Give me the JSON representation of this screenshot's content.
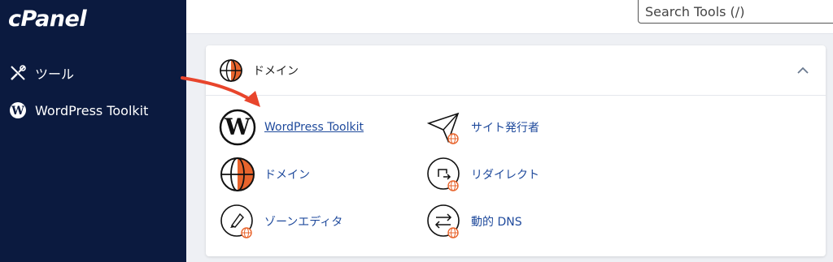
{
  "sidebar": {
    "logo": "cPanel",
    "items": [
      {
        "label": "ツール",
        "icon": "tools-icon"
      },
      {
        "label": "WordPress Toolkit",
        "icon": "wordpress-icon"
      }
    ]
  },
  "search": {
    "placeholder": "Search Tools (/)"
  },
  "panel": {
    "title": "ドメイン",
    "icon": "globe-icon",
    "tools": [
      {
        "label": "WordPress Toolkit",
        "icon": "wordpress-icon"
      },
      {
        "label": "サイト発行者",
        "icon": "paper-plane-icon"
      },
      {
        "label": "ドメイン",
        "icon": "globe-icon"
      },
      {
        "label": "リダイレクト",
        "icon": "redirect-icon"
      },
      {
        "label": "ゾーンエディタ",
        "icon": "zone-editor-icon"
      },
      {
        "label": "動的 DNS",
        "icon": "dynamic-dns-icon"
      }
    ]
  },
  "colors": {
    "sidebar_bg": "#0b1a3f",
    "link": "#1f4a9c",
    "accent": "#e8642c",
    "annotation_arrow": "#e8452c"
  }
}
